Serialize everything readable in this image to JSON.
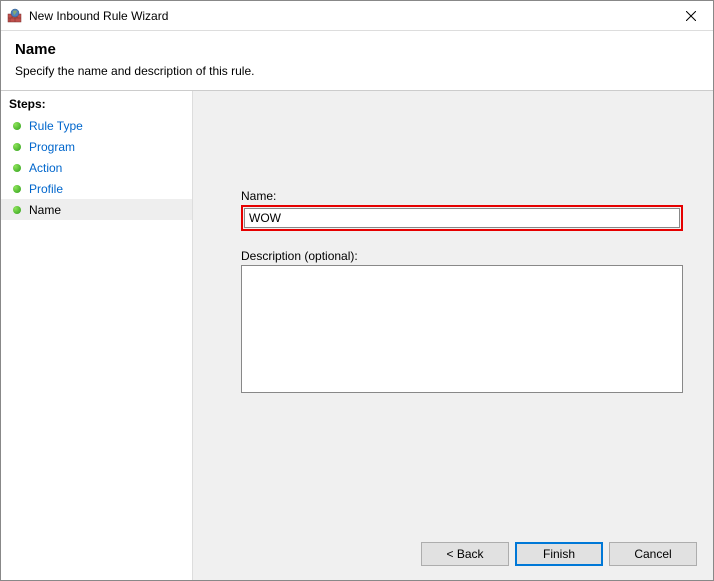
{
  "titlebar": {
    "title": "New Inbound Rule Wizard"
  },
  "header": {
    "title": "Name",
    "description": "Specify the name and description of this rule."
  },
  "sidebar": {
    "title": "Steps:",
    "items": [
      {
        "label": "Rule Type",
        "active": false
      },
      {
        "label": "Program",
        "active": false
      },
      {
        "label": "Action",
        "active": false
      },
      {
        "label": "Profile",
        "active": false
      },
      {
        "label": "Name",
        "active": true
      }
    ]
  },
  "form": {
    "name_label": "Name:",
    "name_value": "WOW",
    "desc_label": "Description (optional):",
    "desc_value": ""
  },
  "buttons": {
    "back": "< Back",
    "finish": "Finish",
    "cancel": "Cancel"
  }
}
